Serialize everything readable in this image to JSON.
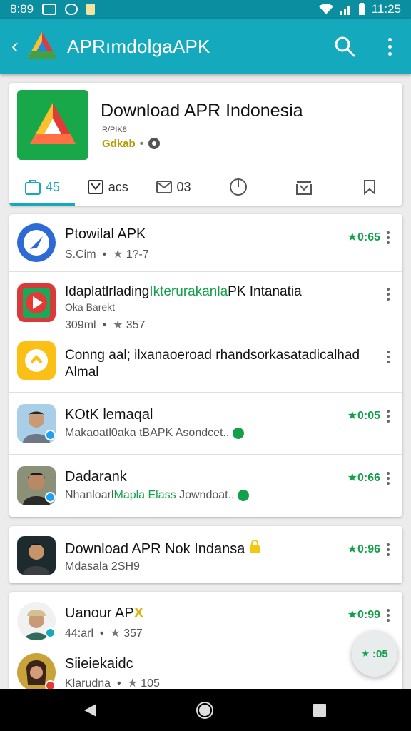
{
  "status_bar": {
    "time_left": "8:89",
    "time_right": "11:25"
  },
  "app_bar": {
    "title": "APRımdolgaAPK",
    "back_icon": "back-chevron-icon",
    "search_icon": "search-icon",
    "more_icon": "more-vertical-icon"
  },
  "header": {
    "title": "Download APR Indonesia",
    "meta": "R/PIK8",
    "sub_label": "Gdkab",
    "tabs": [
      {
        "icon": "bag-icon",
        "label": "45",
        "active": true
      },
      {
        "icon": "image-icon",
        "label": "acs",
        "active": false
      },
      {
        "icon": "mail-icon",
        "label": "03",
        "active": false
      },
      {
        "icon": "shield-icon",
        "label": "",
        "active": false
      },
      {
        "icon": "download-box-icon",
        "label": "",
        "active": false
      },
      {
        "icon": "bookmark-icon",
        "label": "",
        "active": false
      }
    ]
  },
  "list1": {
    "items": [
      {
        "title": "Ptowilal APK",
        "sub": "S.Cim",
        "rating": "1?-7",
        "score": "★0:65"
      },
      {
        "title": "Idaplatlrlading",
        "title_green": "Ikterurakanla",
        "title_end": "PK Intanatia",
        "line2": "Oka Barekt",
        "sub": "309ml",
        "rating": "357"
      },
      {
        "title": "Conng aal; ilxanaoeroad rhandsorkasatadicalhad",
        "line2": "Almal"
      },
      {
        "title": "KOtK lemaqal",
        "sub": "Makaoatl0aka tBAPK Asondcet..",
        "score": "★0:05"
      },
      {
        "title": "Dadarank",
        "sub": "Nhanloarl",
        "sub_green": "Mapla Elass",
        "sub_end": " Jowndoat..",
        "score": "★0:66"
      }
    ]
  },
  "list2": {
    "title": "Download APR Nok Indansa",
    "sub": "Mdasala  2SH9",
    "score": "★0:96"
  },
  "list3": {
    "items": [
      {
        "title": "Uanour AP",
        "title_mark": "X",
        "sub": "44:arl",
        "rating": "357",
        "score": "★0:99"
      },
      {
        "title": "Siieiekaidc",
        "sub": "Klarudna",
        "rating": "105"
      }
    ]
  },
  "fab": {
    "label": ":05"
  },
  "colors": {
    "accent": "#15a9bd",
    "green": "#12a04a",
    "status": "#0a8ea0"
  }
}
